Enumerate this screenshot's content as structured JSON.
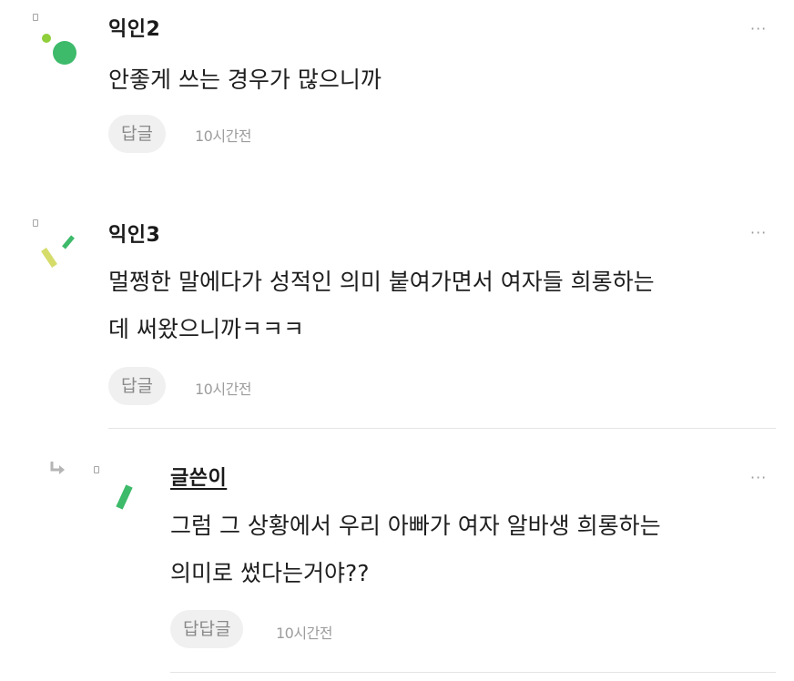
{
  "comments": [
    {
      "author": "익인2",
      "text": "안좋게 쓰는 경우가 많으니까",
      "reply_label": "답글",
      "time": "10시간전",
      "more": "···"
    },
    {
      "author": "익인3",
      "text": "멀쩡한 말에다가 성적인 의미 붙여가면서 여자들 희롱하는\n데 써왔으니까ㅋㅋㅋ",
      "reply_label": "답글",
      "time": "10시간전",
      "more": "···"
    }
  ],
  "reply": {
    "author": "글쓴이",
    "text": "그럼 그 상황에서 우리 아빠가 여자 알바생 희롱하는\n의미로 썼다는거야??",
    "reply_label": "답답글",
    "time": "10시간전",
    "more": "···"
  },
  "colors": {
    "avatar_green": "#3dba6a",
    "avatar_light_green": "#8fcf3a",
    "avatar_yellow": "#d6dc6a",
    "divider": "#e4e4e4"
  }
}
